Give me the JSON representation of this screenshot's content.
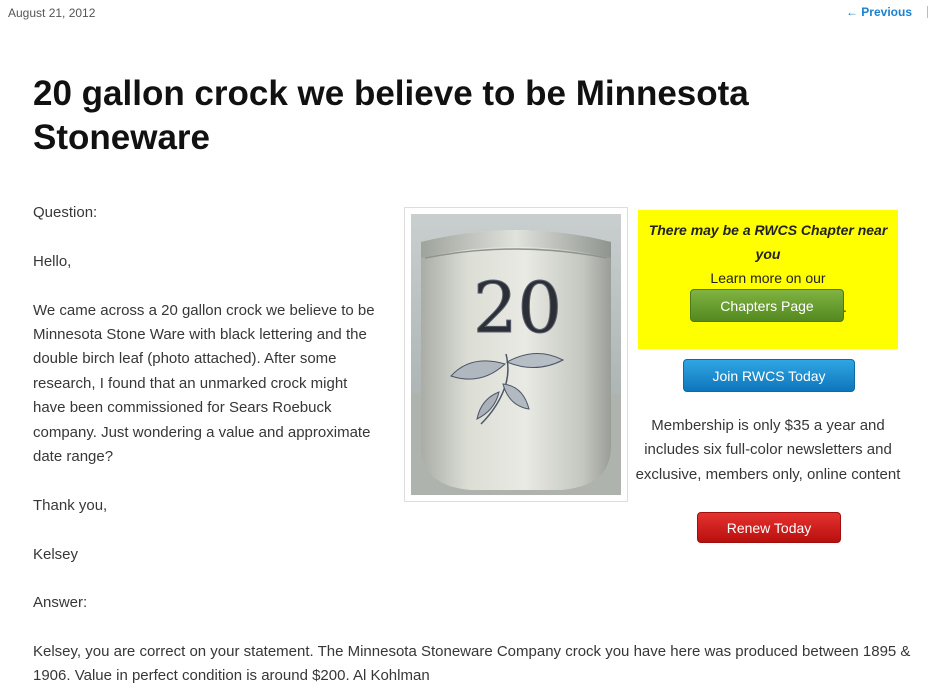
{
  "header": {
    "date": "August 21, 2012",
    "previous_link": "← Previous"
  },
  "post": {
    "title": "20 gallon crock we believe to be Minnesota Stoneware",
    "paragraphs": [
      "Question:",
      "Hello,",
      "We came across a 20 gallon crock we believe to be Minnesota Stone Ware with black lettering and the double birch leaf (photo attached). After some research, I found that an unmarked crock might have been commissioned for Sears Roebuck company. Just wondering a value and approximate date range?",
      "Thank you,",
      "Kelsey",
      "Answer:"
    ],
    "answer": "Kelsey, you are correct on your statement.  The Minnesota Stoneware Company crock you have here was produced between 1895 & 1906.  Value in perfect condition is around $200.   Al Kohlman",
    "photo_number": "20"
  },
  "sidebar": {
    "promo_heading": "There may be a RWCS Chapter near you",
    "promo_learn": "Learn more on our",
    "chapters_button": "Chapters Page",
    "period": ".",
    "join_button": "Join RWCS Today",
    "membership_text": "Membership is only $35 a year and includes six full-color newsletters and exclusive, members only, online content",
    "renew_button": "Renew Today"
  },
  "colors": {
    "link": "#1982d1",
    "promo_background": "#ffff00",
    "chapters_button": "#6aa133",
    "join_button": "#1a8fd1",
    "renew_button": "#d11f1d"
  }
}
